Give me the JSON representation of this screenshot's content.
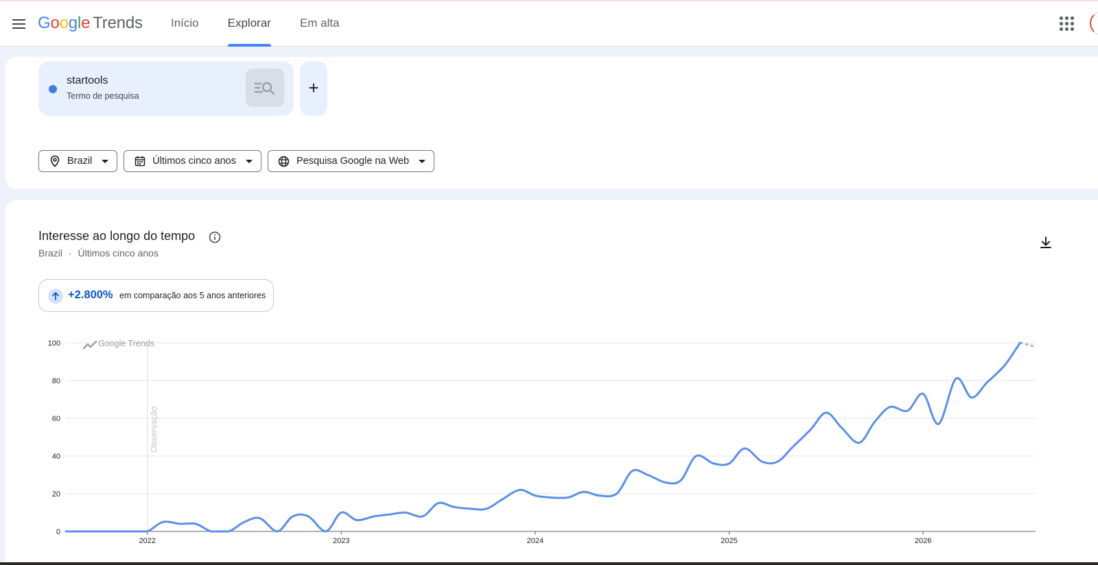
{
  "app": {
    "logo_google": "Google",
    "logo_trends": "Trends",
    "nav": [
      {
        "label": "Início"
      },
      {
        "label": "Explorar"
      },
      {
        "label": "Em alta"
      }
    ],
    "active_tab": "Explorar"
  },
  "search": {
    "term": "startools",
    "term_type": "Termo de pesquisa",
    "term_color": "#3f7de8",
    "add_label": "+"
  },
  "filters": {
    "location": "Brazil",
    "period": "Últimos cinco anos",
    "source": "Pesquisa Google na Web"
  },
  "interest": {
    "title": "Interesse ao longo do tempo",
    "subtitle_location": "Brazil",
    "subtitle_separator": "·",
    "subtitle_period": "Últimos cinco anos",
    "change_value": "+2.800%",
    "change_text": "em comparação aos 5 anos anteriores",
    "watermark": "Google Trends",
    "annotation": "Observação"
  },
  "chart_data": {
    "type": "line",
    "xlabel": "",
    "ylabel": "",
    "ylim": [
      0,
      100
    ],
    "y_ticks": [
      0,
      20,
      40,
      60,
      80,
      100
    ],
    "x_ticks": [
      "2022",
      "2023",
      "2024",
      "2025",
      "2026"
    ],
    "grid": true,
    "line_color": "#5b8fe8",
    "series": [
      {
        "x": [
          2021.58,
          2021.67,
          2021.75,
          2021.83,
          2021.92,
          2022.0,
          2022.08,
          2022.17,
          2022.25,
          2022.33,
          2022.42,
          2022.5,
          2022.58,
          2022.67,
          2022.75,
          2022.83,
          2022.92,
          2023.0,
          2023.08,
          2023.17,
          2023.25,
          2023.33,
          2023.42,
          2023.5,
          2023.58,
          2023.67,
          2023.75,
          2023.83,
          2023.92,
          2024.0,
          2024.08,
          2024.17,
          2024.25,
          2024.33,
          2024.42,
          2024.5,
          2024.58,
          2024.67,
          2024.75,
          2024.83,
          2024.92,
          2025.0,
          2025.08,
          2025.17,
          2025.25,
          2025.33,
          2025.42,
          2025.5,
          2025.58,
          2025.67,
          2025.75,
          2025.83,
          2025.92,
          2026.0,
          2026.08,
          2026.17,
          2026.25,
          2026.33,
          2026.42,
          2026.5
        ],
        "values": [
          0,
          0,
          0,
          0,
          0,
          0,
          5,
          4,
          4,
          0,
          0,
          5,
          7,
          0,
          8,
          8,
          0,
          10,
          6,
          8,
          9,
          10,
          8,
          15,
          13,
          12,
          12,
          17,
          22,
          19,
          18,
          18,
          21,
          19,
          20,
          32,
          30,
          26,
          27,
          40,
          36,
          36,
          44,
          37,
          37,
          45,
          54,
          63,
          55,
          47,
          58,
          66,
          64,
          73,
          57,
          81,
          71,
          79,
          88,
          100
        ]
      }
    ],
    "partial_x": [
      2026.5,
      2026.58
    ],
    "partial_values": [
      100,
      98
    ]
  }
}
